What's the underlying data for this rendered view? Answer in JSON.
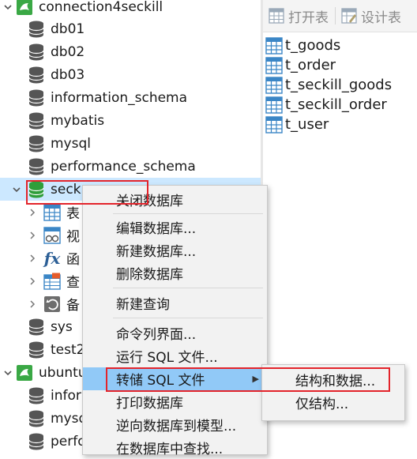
{
  "tree": {
    "items": [
      {
        "label": "connection4seckill",
        "kind": "connection",
        "expanded": true
      },
      {
        "label": "db01",
        "kind": "database"
      },
      {
        "label": "db02",
        "kind": "database"
      },
      {
        "label": "db03",
        "kind": "database"
      },
      {
        "label": "information_schema",
        "kind": "database"
      },
      {
        "label": "mybatis",
        "kind": "database"
      },
      {
        "label": "mysql",
        "kind": "database"
      },
      {
        "label": "performance_schema",
        "kind": "database"
      },
      {
        "label": "seck",
        "kind": "database-open",
        "expanded": true,
        "selected": true
      },
      {
        "label": "表",
        "kind": "tables"
      },
      {
        "label": "视",
        "kind": "views"
      },
      {
        "label": "函",
        "kind": "functions"
      },
      {
        "label": "查",
        "kind": "queries"
      },
      {
        "label": "备",
        "kind": "backups"
      },
      {
        "label": "sys",
        "kind": "database"
      },
      {
        "label": "test2",
        "kind": "database"
      },
      {
        "label": "ubuntu",
        "kind": "connection",
        "expanded": true
      },
      {
        "label": "infor",
        "kind": "database"
      },
      {
        "label": "mysq",
        "kind": "database"
      },
      {
        "label": "perfo",
        "kind": "database"
      }
    ]
  },
  "toolbar": {
    "open_table": "打开表",
    "design_table": "设计表"
  },
  "tables": [
    "t_goods",
    "t_order",
    "t_seckill_goods",
    "t_seckill_order",
    "t_user"
  ],
  "context_menu": {
    "items": [
      "关闭数据库",
      "编辑数据库...",
      "新建数据库...",
      "删除数据库",
      "新建查询",
      "命令列界面...",
      "运行 SQL 文件...",
      "转储 SQL 文件",
      "打印数据库",
      "逆向数据库到模型...",
      "在数据库中查找..."
    ],
    "highlighted": "转储 SQL 文件"
  },
  "submenu": {
    "items": [
      "结构和数据...",
      "仅结构..."
    ]
  },
  "colors": {
    "selection": "#cce8ff",
    "menu_highlight": "#91c9f7",
    "annotation_red": "#e3242b",
    "connection_green": "#3aa845",
    "table_blue": "#3b86c6"
  }
}
